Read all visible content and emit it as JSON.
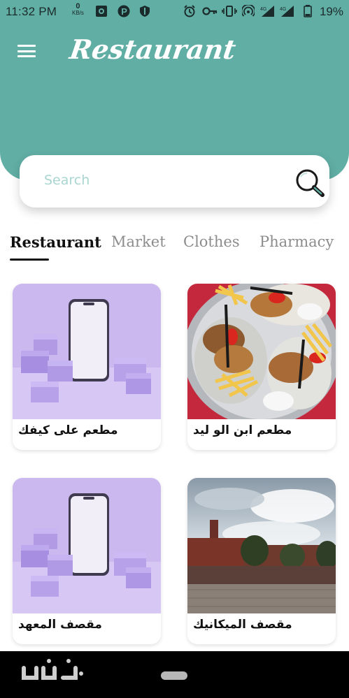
{
  "status_bar": {
    "time": "11:32 PM",
    "speed_value": "0",
    "speed_unit": "KB/s",
    "battery": "19%"
  },
  "header": {
    "title": "Restaurant",
    "menu_icon": "hamburger-menu-icon"
  },
  "search": {
    "placeholder": "Search",
    "icon": "search-icon"
  },
  "tabs": [
    {
      "label": "Restaurant",
      "active": true
    },
    {
      "label": "Market",
      "active": false
    },
    {
      "label": "Clothes",
      "active": false
    },
    {
      "label": "Pharmacy",
      "active": false
    }
  ],
  "cards": [
    {
      "title": "مطعم على كيفك",
      "image": "phone-with-boxes-illustration"
    },
    {
      "title": "مطعم ابن الو ليد",
      "image": "food-platter-photo"
    },
    {
      "title": "مقصف المعهد",
      "image": "phone-with-boxes-illustration"
    },
    {
      "title": "مقصف الميكانيك",
      "image": "building-courtyard-photo"
    }
  ],
  "colors": {
    "primary": "#61aea5",
    "card_purple": "#cbb8ef",
    "food_red": "#c4283c"
  }
}
